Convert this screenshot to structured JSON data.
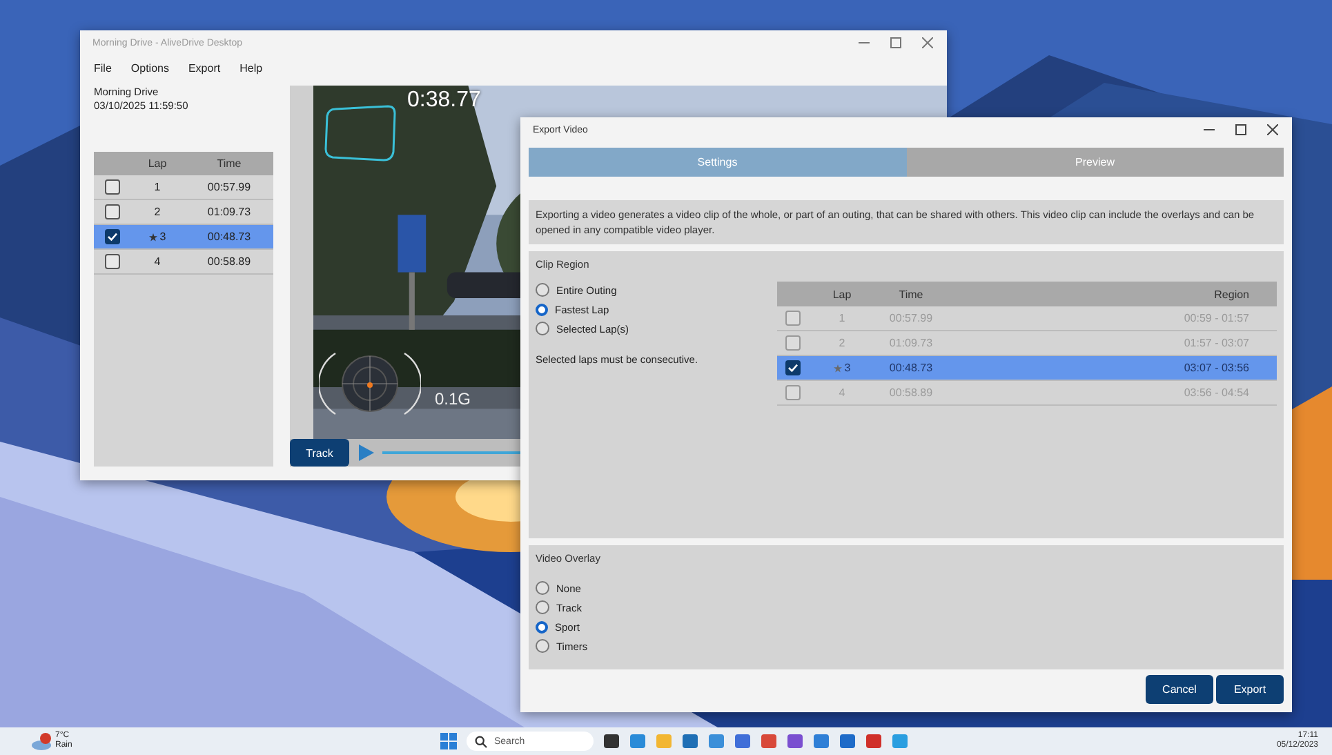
{
  "main_window": {
    "title": "Morning Drive - AliveDrive Desktop",
    "menu": [
      "File",
      "Options",
      "Export",
      "Help"
    ],
    "outing": {
      "name": "Morning Drive",
      "datetime": "03/10/2025 11:59:50"
    },
    "laps": {
      "columns": [
        "Lap",
        "Time"
      ],
      "rows": [
        {
          "checked": false,
          "selected": false,
          "fastest": false,
          "lap": "1",
          "time": "00:57.99"
        },
        {
          "checked": false,
          "selected": false,
          "fastest": false,
          "lap": "2",
          "time": "01:09.73"
        },
        {
          "checked": true,
          "selected": true,
          "fastest": true,
          "lap": "3",
          "time": "00:48.73"
        },
        {
          "checked": false,
          "selected": false,
          "fastest": false,
          "lap": "4",
          "time": "00:58.89"
        }
      ]
    },
    "video": {
      "lap_time": "0:38.77",
      "g_force": "0.1G"
    },
    "track_button": "Track"
  },
  "export_dialog": {
    "title": "Export Video",
    "tabs": [
      {
        "label": "Settings",
        "selected": true
      },
      {
        "label": "Preview",
        "selected": false
      }
    ],
    "description": "Exporting a video generates a video clip of the whole, or part of an outing, that can be shared with others. This video clip can include the overlays and can be opened in any compatible video player.",
    "clip_region": {
      "title": "Clip Region",
      "options": [
        {
          "label": "Entire Outing",
          "selected": false
        },
        {
          "label": "Fastest Lap",
          "selected": true
        },
        {
          "label": "Selected Lap(s)",
          "selected": false
        }
      ],
      "note": "Selected laps must be consecutive.",
      "table": {
        "disabled": true,
        "columns": [
          "Lap",
          "Time",
          "Region"
        ],
        "rows": [
          {
            "checked": false,
            "selected": false,
            "fastest": false,
            "lap": "1",
            "time": "00:57.99",
            "region": "00:59 - 01:57"
          },
          {
            "checked": false,
            "selected": false,
            "fastest": false,
            "lap": "2",
            "time": "01:09.73",
            "region": "01:57 - 03:07"
          },
          {
            "checked": true,
            "selected": true,
            "fastest": true,
            "lap": "3",
            "time": "00:48.73",
            "region": "03:07 - 03:56"
          },
          {
            "checked": false,
            "selected": false,
            "fastest": false,
            "lap": "4",
            "time": "00:58.89",
            "region": "03:56 - 04:54"
          }
        ]
      }
    },
    "video_overlay": {
      "title": "Video Overlay",
      "options": [
        {
          "label": "None",
          "selected": false
        },
        {
          "label": "Track",
          "selected": false
        },
        {
          "label": "Sport",
          "selected": true
        },
        {
          "label": "Timers",
          "selected": false
        }
      ]
    },
    "buttons": [
      "Cancel",
      "Export"
    ]
  },
  "taskbar": {
    "weather": {
      "temperature": "7°C",
      "condition": "Rain"
    },
    "search": {
      "placeholder": "Search"
    },
    "clock": {
      "time": "17:11",
      "date": "05/12/2023"
    }
  }
}
